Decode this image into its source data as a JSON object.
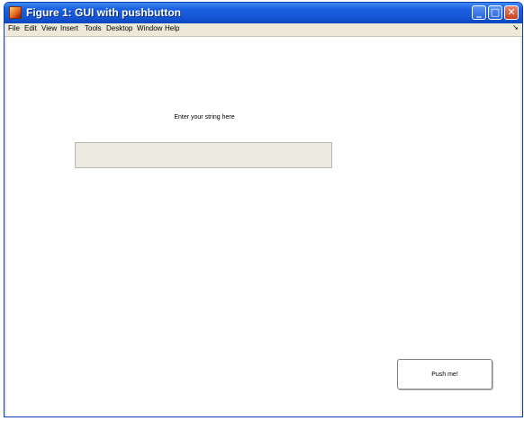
{
  "window": {
    "title": "Figure 1: GUI with pushbutton",
    "controls": {
      "minimize": "_",
      "maximize": "□",
      "close": "✕"
    }
  },
  "menubar": {
    "items": [
      "File",
      "Edit",
      "View",
      "Insert",
      "Tools",
      "Desktop",
      "Window",
      "Help"
    ],
    "overflow_arrow": "➘"
  },
  "content": {
    "prompt_label": "Enter your string here",
    "string_input": {
      "value": "",
      "placeholder": ""
    },
    "push_button_label": "Push me!"
  },
  "colors": {
    "titlebar": "#1556d4",
    "chrome": "#ece9d8",
    "client_background": "#ffffff",
    "input_background": "#ebe9e0"
  }
}
